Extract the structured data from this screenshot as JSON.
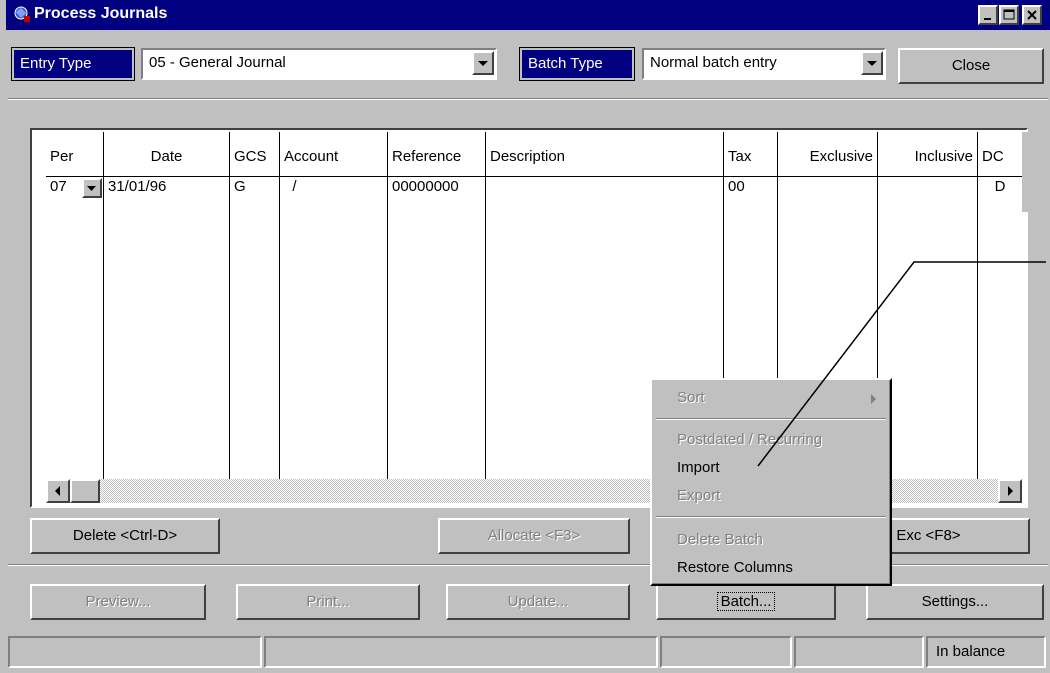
{
  "window": {
    "title": "Process Journals",
    "controls": {
      "minimize": "minimize-icon",
      "maximize": "maximize-icon",
      "close": "close-icon"
    }
  },
  "toolbar": {
    "entry_type_label": "Entry Type",
    "entry_type_value": "05 - General Journal",
    "batch_type_label": "Batch Type",
    "batch_type_value": "Normal batch entry",
    "close_label": "Close"
  },
  "grid": {
    "columns": [
      "Per",
      "Date",
      "GCS",
      "Account",
      "Reference",
      "Description",
      "Tax",
      "Exclusive",
      "Inclusive",
      "DC"
    ],
    "rows": [
      {
        "per": "07",
        "date": "31/01/96",
        "gcs": "G",
        "account": "  /",
        "reference": "00000000",
        "description": "",
        "tax": "00",
        "exclusive": "",
        "inclusive": "",
        "dc": "D"
      }
    ]
  },
  "grid_buttons": {
    "delete": "Delete <Ctrl-D>",
    "allocate": "Allocate <F3>",
    "inc_exc": "nc / Exc <F8>"
  },
  "bottom_buttons": {
    "preview": "Preview...",
    "print": "Print...",
    "update": "Update...",
    "batch": "Batch...",
    "settings": "Settings..."
  },
  "context_menu": {
    "items": [
      {
        "label": "Sort",
        "enabled": false,
        "submenu": true
      },
      {
        "label": "Postdated / Recurring",
        "enabled": false
      },
      {
        "label": "Import",
        "enabled": true
      },
      {
        "label": "Export",
        "enabled": false
      },
      {
        "label": "Delete Batch",
        "enabled": false
      },
      {
        "label": "Restore Columns",
        "enabled": true
      }
    ]
  },
  "status_bar": {
    "panel_6": "In balance"
  },
  "colors": {
    "title_bar": "#000080",
    "face": "#c0c0c0",
    "label_blue": "#000080"
  }
}
